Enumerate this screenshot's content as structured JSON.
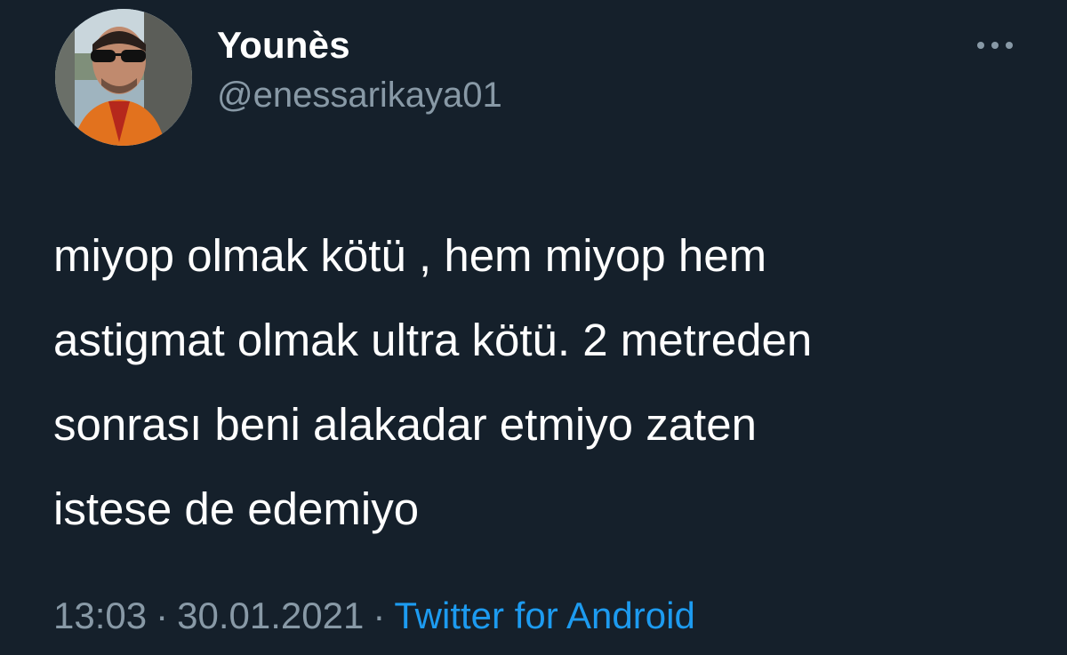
{
  "author": {
    "display_name": "Younès",
    "handle": "@enessarikaya01"
  },
  "tweet": {
    "lines": [
      "miyop olmak kötü , hem miyop hem",
      "astigmat olmak ultra kötü. 2 metreden",
      "sonrası beni alakadar etmiyo zaten",
      "istese de edemiyo"
    ]
  },
  "meta": {
    "time": "13:03",
    "date": "30.01.2021",
    "separator": "·",
    "source": "Twitter for Android"
  },
  "icons": {
    "more": "more-horizontal-icon"
  },
  "colors": {
    "background": "#15202b",
    "text_primary": "#ffffff",
    "text_secondary": "#8899a6",
    "link": "#1d9bf0"
  }
}
